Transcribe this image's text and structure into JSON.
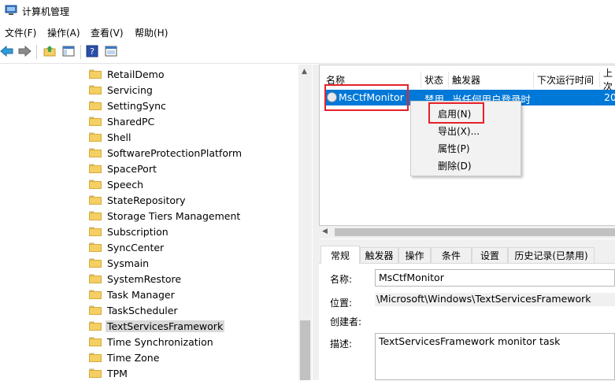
{
  "window": {
    "title": "计算机管理"
  },
  "menu": [
    "文件(F)",
    "操作(A)",
    "查看(V)",
    "帮助(H)"
  ],
  "toolbar": [
    "back-icon",
    "forward-icon",
    "up-folder-icon",
    "show-hide-tree-icon",
    "help-icon",
    "properties-icon"
  ],
  "tree": {
    "items": [
      "RetailDemo",
      "Servicing",
      "SettingSync",
      "SharedPC",
      "Shell",
      "SoftwareProtectionPlatform",
      "SpacePort",
      "Speech",
      "StateRepository",
      "Storage Tiers Management",
      "Subscription",
      "SyncCenter",
      "Sysmain",
      "SystemRestore",
      "Task Manager",
      "TaskScheduler",
      "TextServicesFramework",
      "Time Synchronization",
      "Time Zone",
      "TPM"
    ],
    "selected": "TextServicesFramework"
  },
  "task_list": {
    "columns": [
      "名称",
      "状态",
      "触发器",
      "下次运行时间",
      "上次"
    ],
    "rows": [
      {
        "name": "MsCtfMonitor",
        "status": "禁用",
        "trigger": "当任何用户登录时",
        "last_run": "20"
      }
    ]
  },
  "context_menu": [
    "启用(N)",
    "导出(X)...",
    "属性(P)",
    "删除(D)"
  ],
  "details": {
    "tabs": [
      "常规",
      "触发器",
      "操作",
      "条件",
      "设置",
      "历史记录(已禁用)"
    ],
    "active_tab": "常规",
    "labels": {
      "name": "名称:",
      "location": "位置:",
      "author": "创建者:",
      "description": "描述:"
    },
    "values": {
      "name": "MsCtfMonitor",
      "location": "\\Microsoft\\Windows\\TextServicesFramework",
      "description": "TextServicesFramework monitor task"
    }
  },
  "colors": {
    "selection": "#0078d7",
    "highlight_box": "#e8202a",
    "folder": "#f4cf63"
  }
}
